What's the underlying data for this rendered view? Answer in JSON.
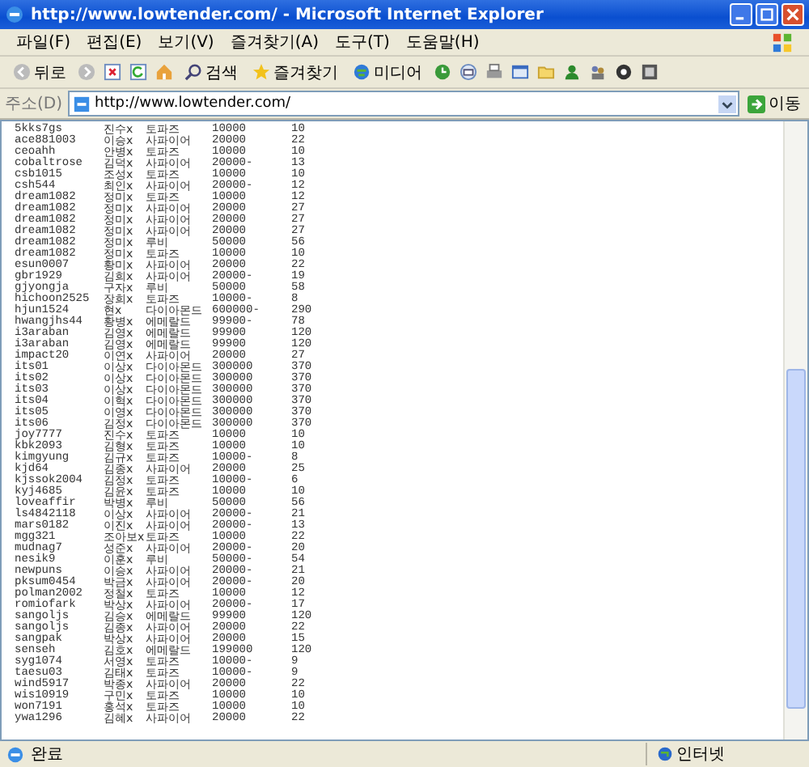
{
  "window": {
    "title": "http://www.lowtender.com/ - Microsoft Internet Explorer"
  },
  "menu": [
    "파일(F)",
    "편집(E)",
    "보기(V)",
    "즐겨찾기(A)",
    "도구(T)",
    "도움말(H)"
  ],
  "toolbar": {
    "back": "뒤로",
    "search": "검색",
    "favorites": "즐겨찾기",
    "media": "미디어"
  },
  "address_bar": {
    "label": "주소(D)",
    "value": "http://www.lowtender.com/",
    "go": "이동"
  },
  "table": {
    "rows": [
      [
        "5kks7gs",
        "진수x",
        "토파즈",
        "10000",
        "10"
      ],
      [
        "ace881003",
        "이승x",
        "사파이어",
        "20000",
        "22"
      ],
      [
        "ceoahh",
        "안병x",
        "토파즈",
        "10000",
        "10"
      ],
      [
        "cobaltrose",
        "김덕x",
        "사파이어",
        "20000-",
        "13"
      ],
      [
        "csb1015",
        "조성x",
        "토파즈",
        "10000",
        "10"
      ],
      [
        "csh544",
        "최인x",
        "사파이어",
        "20000-",
        "12"
      ],
      [
        "dream1082",
        "정미x",
        "토파즈",
        "10000",
        "12"
      ],
      [
        "dream1082",
        "정미x",
        "사파이어",
        "20000",
        "27"
      ],
      [
        "dream1082",
        "정미x",
        "사파이어",
        "20000",
        "27"
      ],
      [
        "dream1082",
        "정미x",
        "사파이어",
        "20000",
        "27"
      ],
      [
        "dream1082",
        "정미x",
        "루비",
        "50000",
        "56"
      ],
      [
        "dream1082",
        "정미x",
        "토파즈",
        "10000",
        "10"
      ],
      [
        "esun0007",
        "황미x",
        "사파이어",
        "20000",
        "22"
      ],
      [
        "gbr1929",
        "김희x",
        "사파이어",
        "20000-",
        "19"
      ],
      [
        "gjyongja",
        "구자x",
        "루비",
        "50000",
        "58"
      ],
      [
        "hichoon2525",
        "장희x",
        "토파즈",
        "10000-",
        "8"
      ],
      [
        "hjun1524",
        "현x",
        "다이아몬드",
        "600000-",
        "290"
      ],
      [
        "hwangjhs44",
        "황병x",
        "에메랄드",
        "99900-",
        "78"
      ],
      [
        "i3araban",
        "김영x",
        "에메랄드",
        "99900",
        "120"
      ],
      [
        "i3araban",
        "김영x",
        "에메랄드",
        "99900",
        "120"
      ],
      [
        "impact20",
        "이연x",
        "사파이어",
        "20000",
        "27"
      ],
      [
        "its01",
        "이상x",
        "다이아몬드",
        "300000",
        "370"
      ],
      [
        "its02",
        "이상x",
        "다이아몬드",
        "300000",
        "370"
      ],
      [
        "its03",
        "이상x",
        "다이아몬드",
        "300000",
        "370"
      ],
      [
        "its04",
        "이혁x",
        "다이아몬드",
        "300000",
        "370"
      ],
      [
        "its05",
        "이영x",
        "다이아몬드",
        "300000",
        "370"
      ],
      [
        "its06",
        "김정x",
        "다이아몬드",
        "300000",
        "370"
      ],
      [
        "joy7777",
        "진수x",
        "토파즈",
        "10000",
        "10"
      ],
      [
        "kbk2093",
        "김형x",
        "토파즈",
        "10000",
        "10"
      ],
      [
        "kimgyung",
        "김규x",
        "토파즈",
        "10000-",
        "8"
      ],
      [
        "kjd64",
        "김종x",
        "사파이어",
        "20000",
        "25"
      ],
      [
        "kjssok2004",
        "김정x",
        "토파즈",
        "10000-",
        "6"
      ],
      [
        "kyj4685",
        "김윤x",
        "토파즈",
        "10000",
        "10"
      ],
      [
        "loveaffir",
        "박병x",
        "루비",
        "50000",
        "56"
      ],
      [
        "ls4842118",
        "이상x",
        "사파이어",
        "20000-",
        "21"
      ],
      [
        "mars0182",
        "이진x",
        "사파이어",
        "20000-",
        "13"
      ],
      [
        "mgg321",
        "조아보x",
        "토파즈",
        "10000",
        "22"
      ],
      [
        "mudnag7",
        "성준x",
        "사파이어",
        "20000-",
        "20"
      ],
      [
        "nesik9",
        "이훈x",
        "루비",
        "50000-",
        "54"
      ],
      [
        "newpuns",
        "이승x",
        "사파이어",
        "20000-",
        "21"
      ],
      [
        "pksum0454",
        "박금x",
        "사파이어",
        "20000-",
        "20"
      ],
      [
        "polman2002",
        "정철x",
        "토파즈",
        "10000",
        "12"
      ],
      [
        "romiofark",
        "박상x",
        "사파이어",
        "20000-",
        "17"
      ],
      [
        "sangoljs",
        "김승x",
        "에메랄드",
        "99900",
        "120"
      ],
      [
        "sangoljs",
        "김종x",
        "사파이어",
        "20000",
        "22"
      ],
      [
        "sangpak",
        "박상x",
        "사파이어",
        "20000",
        "15"
      ],
      [
        "senseh",
        "김호x",
        "에메랄드",
        "199000",
        "120"
      ],
      [
        "syg1074",
        "서영x",
        "토파즈",
        "10000-",
        "9"
      ],
      [
        "taesu03",
        "김태x",
        "토파즈",
        "10000-",
        "9"
      ],
      [
        "wind5917",
        "박종x",
        "사파이어",
        "20000",
        "22"
      ],
      [
        "wis10919",
        "구민x",
        "토파즈",
        "10000",
        "10"
      ],
      [
        "won7191",
        "홍석x",
        "토파즈",
        "10000",
        "10"
      ],
      [
        "ywa1296",
        "김혜x",
        "사파이어",
        "20000",
        "22"
      ]
    ]
  },
  "status_bar": {
    "text": "완료",
    "zone": "인터넷"
  }
}
